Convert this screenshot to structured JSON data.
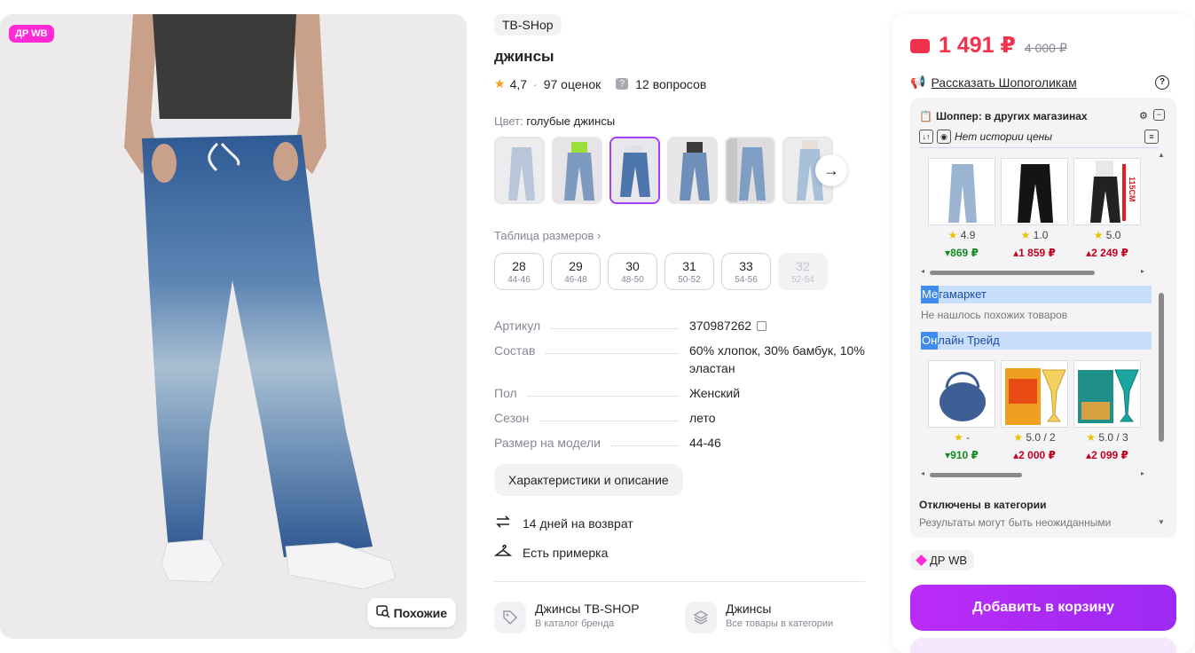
{
  "photo": {
    "badge": "ДР WB",
    "similar_label": "Похожие"
  },
  "product": {
    "brand": "TB-SHop",
    "title": "джинсы",
    "rating": "4,7",
    "reviews": "97 оценок",
    "questions": "12 вопросов",
    "color_label": "Цвет:",
    "color_value": "голубые джинсы",
    "size_table_label": "Таблица размеров",
    "sizes": [
      {
        "n": "28",
        "r": "44-46",
        "available": true
      },
      {
        "n": "29",
        "r": "46-48",
        "available": true
      },
      {
        "n": "30",
        "r": "48-50",
        "available": true
      },
      {
        "n": "31",
        "r": "50-52",
        "available": true
      },
      {
        "n": "33",
        "r": "54-56",
        "available": true
      },
      {
        "n": "32",
        "r": "52-54",
        "available": false
      }
    ],
    "specs": [
      {
        "k": "Артикул",
        "v": "370987262"
      },
      {
        "k": "Состав",
        "v": "60% хлопок, 30% бамбук, 10% эластан"
      },
      {
        "k": "Пол",
        "v": "Женский"
      },
      {
        "k": "Сезон",
        "v": "лето"
      },
      {
        "k": "Размер на модели",
        "v": "44-46"
      }
    ],
    "description_button": "Характеристики и описание",
    "return_text": "14 дней на возврат",
    "fitting_text": "Есть примерка",
    "brand_link_title": "Джинсы TB-SHOP",
    "brand_link_sub": "В каталог бренда",
    "category_link_title": "Джинсы",
    "category_link_sub": "Все товары в категории"
  },
  "buy": {
    "price": "1 491 ₽",
    "old_price": "4 000 ₽",
    "share_text": "Рассказать Шопоголикам",
    "add_to_cart": "Добавить в корзину",
    "dr_chip": "ДР WB"
  },
  "shopper": {
    "title_bold": "Шоппер:",
    "title_rest": "в других магазинах",
    "no_history": "Нет истории цены",
    "row1": [
      {
        "rating": "4.9",
        "price": "869 ₽",
        "dir": "down"
      },
      {
        "rating": "1.0",
        "price": "1 859 ₽",
        "dir": "up"
      },
      {
        "rating": "5.0",
        "price": "2 249 ₽",
        "dir": "up"
      }
    ],
    "store1_hl": "Ме",
    "store1_rest": "гамаркет",
    "store1_note": "Не нашлось похожих товаров",
    "store2_hl": "Он",
    "store2_rest": "лайн Трейд",
    "row2": [
      {
        "rating": "-",
        "price": "910 ₽",
        "dir": "down"
      },
      {
        "rating": "5.0 / 2",
        "price": "2 000 ₽",
        "dir": "up"
      },
      {
        "rating": "5.0 / 3",
        "price": "2 099 ₽",
        "dir": "up"
      }
    ],
    "disabled_title": "Отключены в категории",
    "disabled_sub": "Результаты могут быть неожиданными",
    "tag_115": "115CM"
  }
}
